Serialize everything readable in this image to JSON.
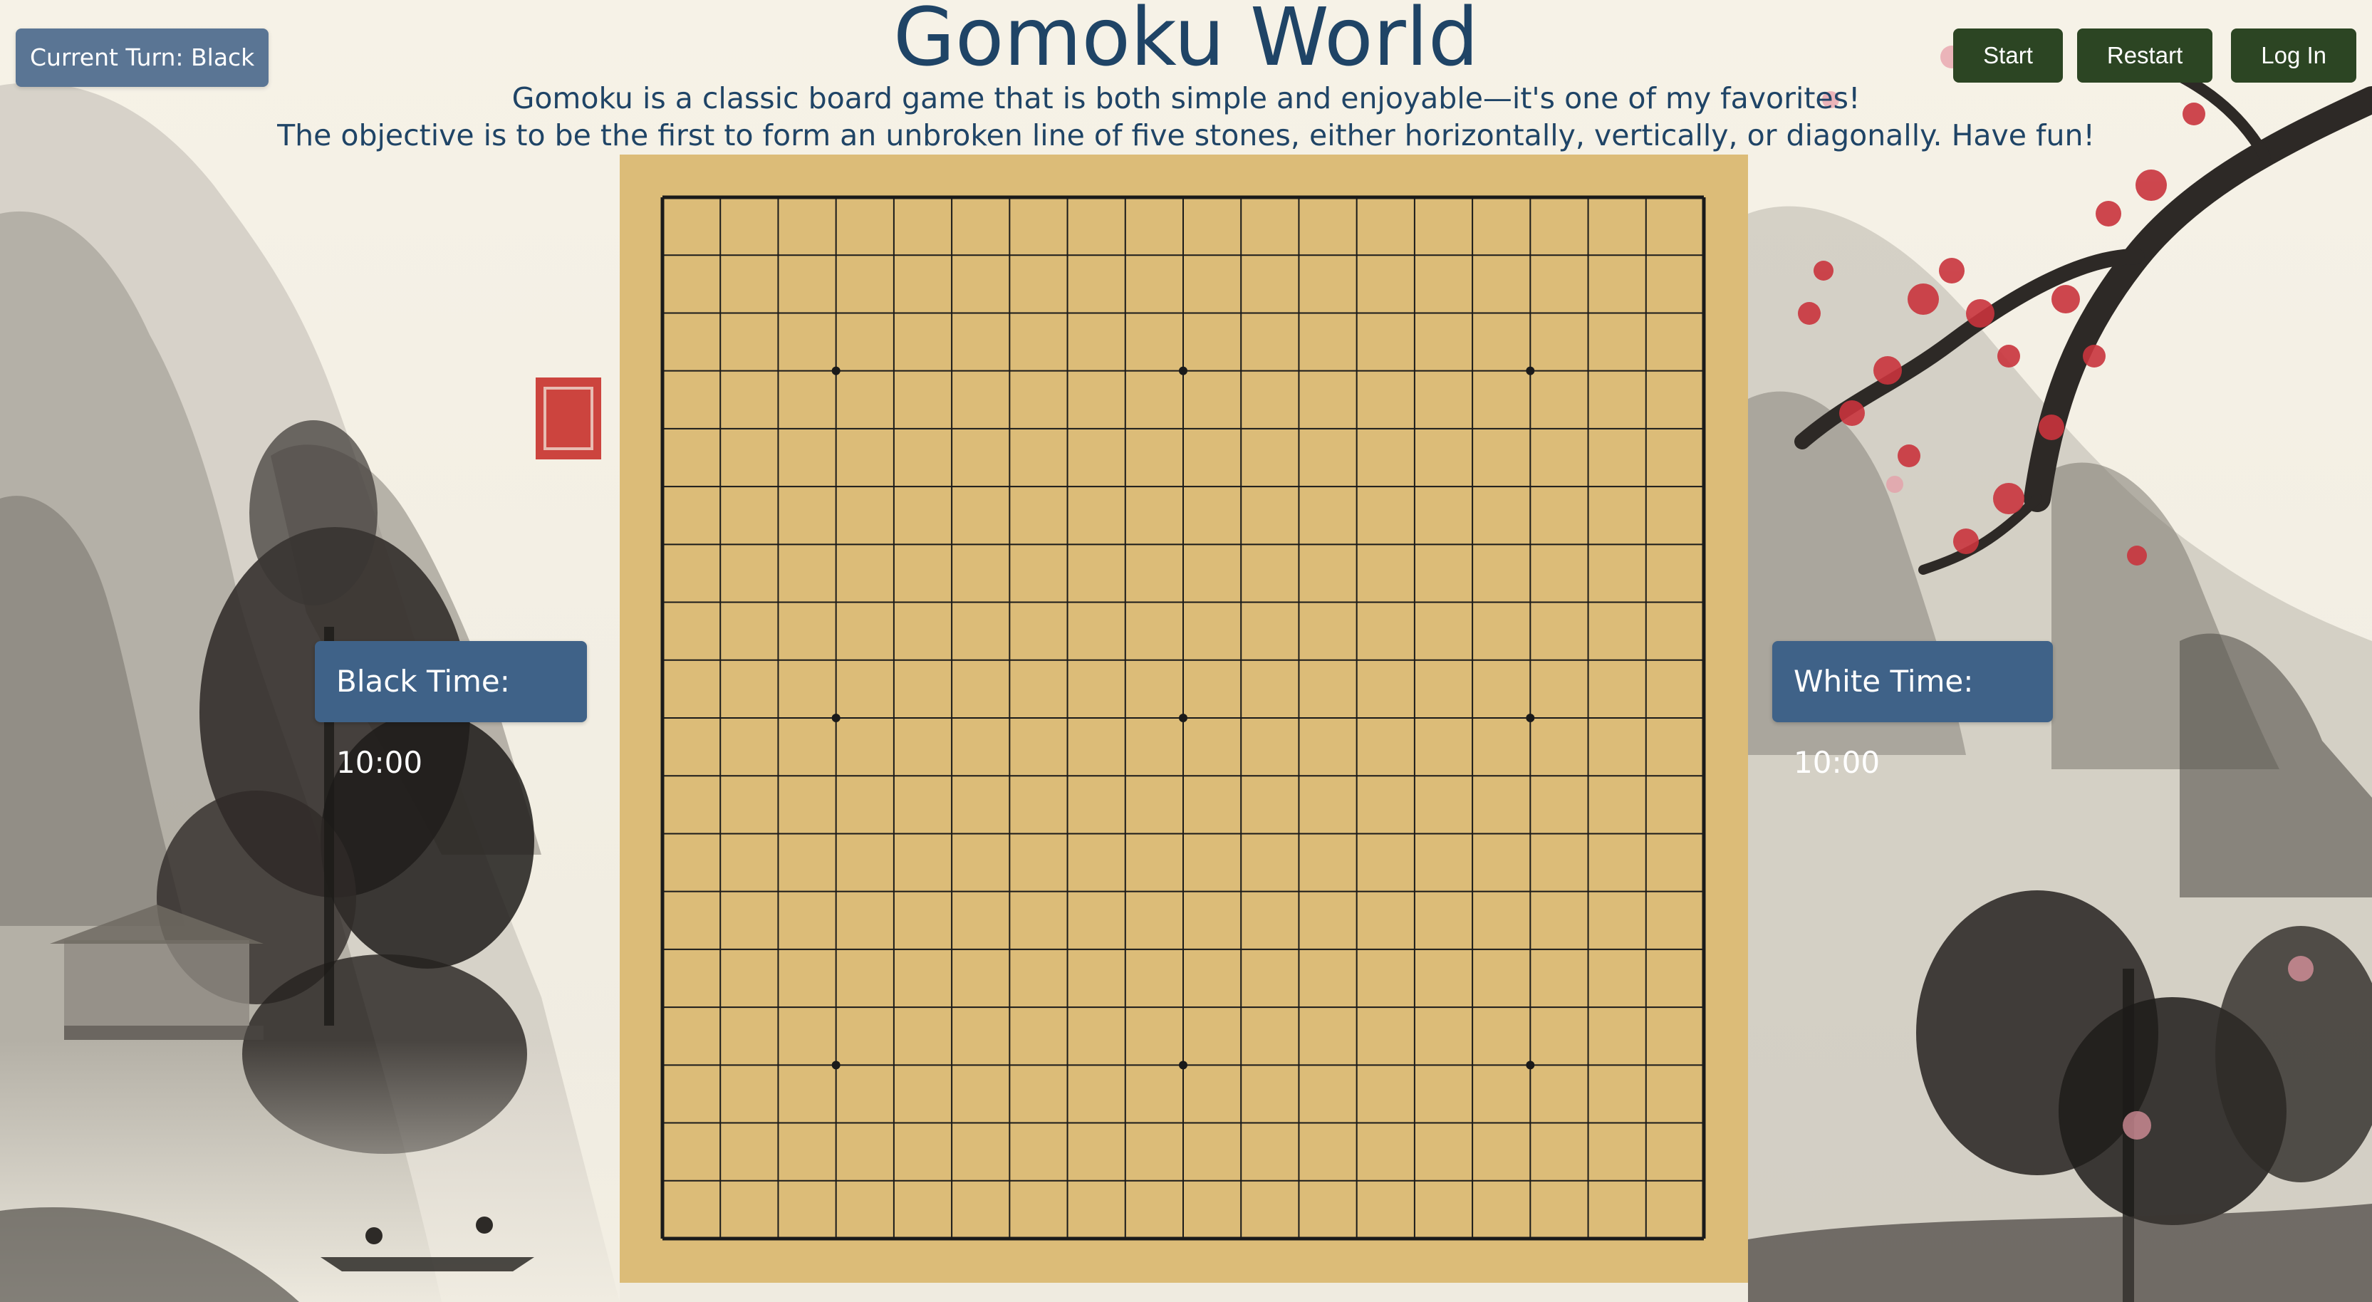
{
  "header": {
    "current_turn": "Current Turn: Black",
    "title": "Gomoku World",
    "intro_line_1": "Gomoku is a classic board game that is both simple and enjoyable—it's one of my favorites!",
    "intro_line_2": "The objective is to be the first to form an unbroken line of five stones, either horizontally, vertically, or diagonally. Have fun!"
  },
  "toolbar": {
    "start_label": "Start",
    "restart_label": "Restart",
    "login_label": "Log In"
  },
  "timers": {
    "black": "Black Time: 10:00",
    "white": "White Time: 10:00"
  },
  "board": {
    "size": 19,
    "star_points": [
      [
        3,
        3
      ],
      [
        3,
        9
      ],
      [
        3,
        15
      ],
      [
        9,
        3
      ],
      [
        9,
        9
      ],
      [
        9,
        15
      ],
      [
        15,
        3
      ],
      [
        15,
        9
      ],
      [
        15,
        15
      ]
    ],
    "stones": []
  },
  "colors": {
    "board": "#dcbc78",
    "grid_line": "#1a1a1a",
    "title": "#1f4466",
    "turn_badge": "#5a7594",
    "timer_badge": "#3f6288",
    "action_button": "#2c4523",
    "seal_red": "#c8312b",
    "blossom_red": "#c9343d"
  }
}
